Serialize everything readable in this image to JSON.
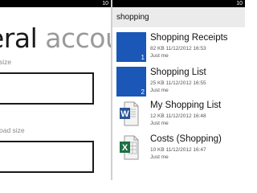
{
  "left_screen": {
    "status_time": "10",
    "title": "eral",
    "title_accent": "accour",
    "fields": [
      {
        "label": "size"
      },
      {
        "label": "oad size"
      }
    ]
  },
  "right_screen": {
    "status_time": "10",
    "search": {
      "query": "shopping"
    },
    "results": [
      {
        "name": "Shopping Receipts",
        "meta": "82 KB  11/12/2012 16:53",
        "date": "Just me",
        "thumb": "tile",
        "number": "1",
        "color": "#1a57b7"
      },
      {
        "name": "Shopping List",
        "meta": "25 KB  11/12/2012 16:55",
        "date": "Just me",
        "thumb": "tile",
        "number": "2",
        "color": "#1a57b7"
      },
      {
        "name": "My Shopping List",
        "meta": "12 KB  11/12/2012 16:48",
        "date": "Just me",
        "thumb": "word-doc-icon"
      },
      {
        "name": "Costs (Shopping)",
        "meta": "10 KB  11/12/2012 16:47",
        "date": "Just me",
        "thumb": "excel-doc-icon"
      }
    ]
  }
}
